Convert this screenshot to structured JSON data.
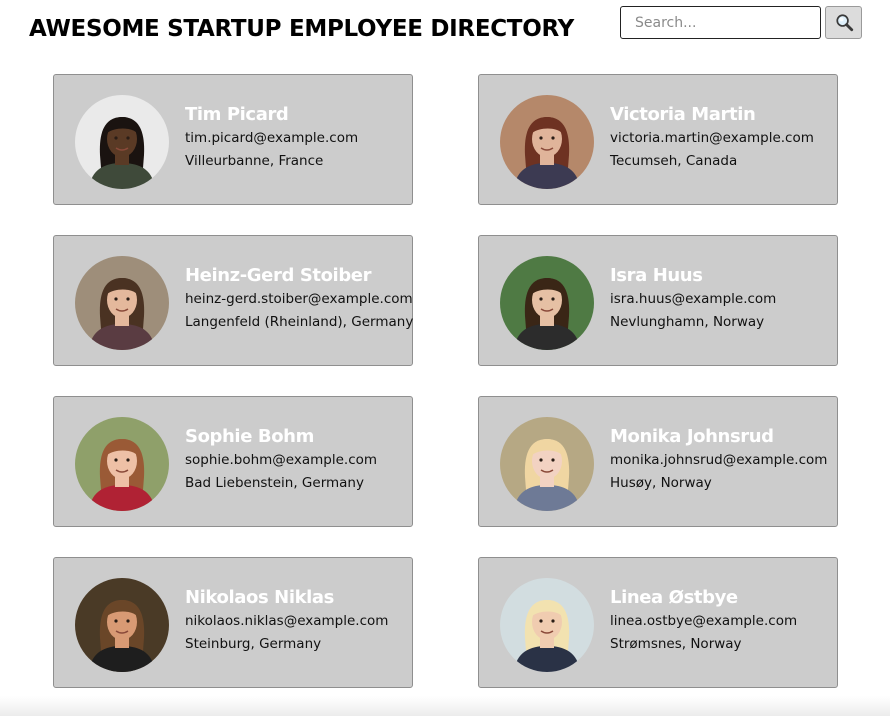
{
  "header": {
    "title": "AWESOME STARTUP EMPLOYEE DIRECTORY",
    "search": {
      "placeholder": "Search...",
      "value": "",
      "button_icon": "search-icon"
    }
  },
  "employees": [
    {
      "name": "Tim Picard",
      "email": "tim.picard@example.com",
      "location": "Villeurbanne, France",
      "avatar_bg": "#eaeaea",
      "skin": "#5a3a25",
      "hair": "#1a1310",
      "shirt": "#3f4a3a"
    },
    {
      "name": "Victoria Martin",
      "email": "victoria.martin@example.com",
      "location": "Tecumseh, Canada",
      "avatar_bg": "#b5886a",
      "skin": "#e0b49a",
      "hair": "#6e3222",
      "shirt": "#3c3a52"
    },
    {
      "name": "Heinz-Gerd Stoiber",
      "email": "heinz-gerd.stoiber@example.com",
      "location": "Langenfeld (Rheinland), Germany",
      "avatar_bg": "#9e8e7a",
      "skin": "#e4b89c",
      "hair": "#4a3222",
      "shirt": "#5a3c42"
    },
    {
      "name": "Isra Huus",
      "email": "isra.huus@example.com",
      "location": "Nevlunghamn, Norway",
      "avatar_bg": "#4f7a44",
      "skin": "#e6c0a4",
      "hair": "#3a2616",
      "shirt": "#2c2c2c"
    },
    {
      "name": "Sophie Bohm",
      "email": "sophie.bohm@example.com",
      "location": "Bad Liebenstein, Germany",
      "avatar_bg": "#8fa06a",
      "skin": "#eec0a6",
      "hair": "#9a5a36",
      "shirt": "#b02234"
    },
    {
      "name": "Monika Johnsrud",
      "email": "monika.johnsrud@example.com",
      "location": "Husøy, Norway",
      "avatar_bg": "#b6a884",
      "skin": "#f2d2c2",
      "hair": "#f0d6a2",
      "shirt": "#6e7a96"
    },
    {
      "name": "Nikolaos Niklas",
      "email": "nikolaos.niklas@example.com",
      "location": "Steinburg, Germany",
      "avatar_bg": "#4a3a26",
      "skin": "#d89a74",
      "hair": "#6a4628",
      "shirt": "#1e1e1e"
    },
    {
      "name": "Linea Østbye",
      "email": "linea.ostbye@example.com",
      "location": "Strømsnes, Norway",
      "avatar_bg": "#d2dde0",
      "skin": "#f0ccb0",
      "hair": "#f2e2b0",
      "shirt": "#2a3246"
    }
  ]
}
